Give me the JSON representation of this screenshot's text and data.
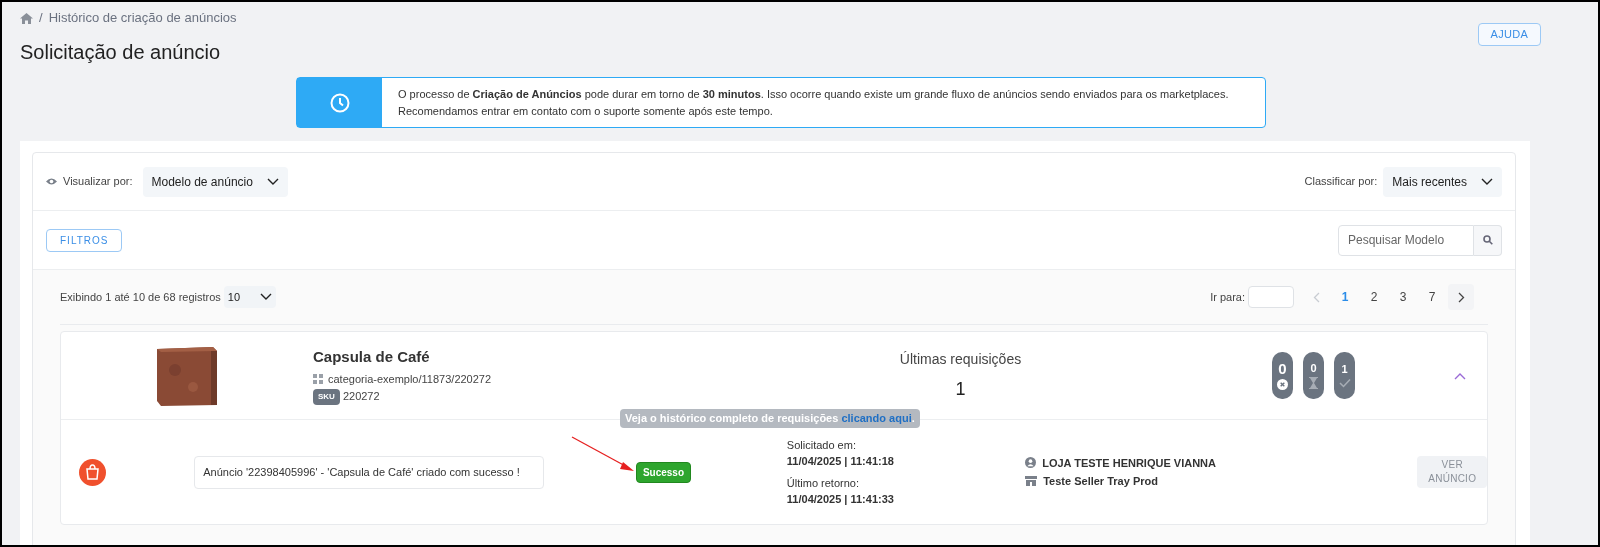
{
  "breadcrumb": {
    "separator": "/",
    "items": [
      "Histórico de criação de anúncios"
    ]
  },
  "title": "Solicitação de anúncio",
  "help_button": "AJUDA",
  "alert": {
    "lines": [
      "O processo de **Criação de Anúncios** pode durar em torno de **30 minutos**. Isso ocorre quando existe um grande fluxo de anúncios sendo enviados para os marketplaces.",
      "Recomendamos entrar em contato com o suporte somente após este tempo."
    ]
  },
  "view_by": {
    "label": "Visualizar por:",
    "value": "Modelo de anúncio"
  },
  "sort_by": {
    "label": "Classificar por:",
    "value": "Mais recentes"
  },
  "filters_button": "FILTROS",
  "search": {
    "placeholder": "Pesquisar Modelo"
  },
  "records": {
    "text": "Exibindo 1 até 10 de 68 registros",
    "page_size": "10"
  },
  "pagination": {
    "goto_label": "Ir para:",
    "prev_disabled": true,
    "pages": [
      {
        "label": "1",
        "selected": true
      },
      {
        "label": "2",
        "selected": false
      },
      {
        "label": "3",
        "selected": false
      },
      {
        "label": "7",
        "selected": false
      }
    ]
  },
  "item": {
    "title": "Capsula de Café",
    "category": "categoria-exemplo/11873/220272",
    "sku_badge": "SKU",
    "sku": "220272",
    "requests_label": "Últimas requisições",
    "requests_count": "1",
    "expanded": true,
    "counters": [
      {
        "kind": "error",
        "count": "0"
      },
      {
        "kind": "pending",
        "count": "0"
      },
      {
        "kind": "success",
        "count": "1"
      }
    ],
    "tooltip": {
      "text": "Veja o histórico completo de requisições",
      "link": "clicando aqui",
      "end": "."
    },
    "result": {
      "message": "Anúncio '22398405996' - 'Capsula de Café' criado com sucesso !",
      "status": "Sucesso",
      "requested_label": "Solicitado em:",
      "requested_at": "11/04/2025 | 11:41:18",
      "returned_label": "Último retorno:",
      "returned_at": "11/04/2025 | 11:41:33",
      "store": "LOJA TESTE HENRIQUE VIANNA",
      "seller": "Teste Seller Tray Prod",
      "view_button": "VER ANÚNCIO",
      "view_disabled": true
    }
  }
}
